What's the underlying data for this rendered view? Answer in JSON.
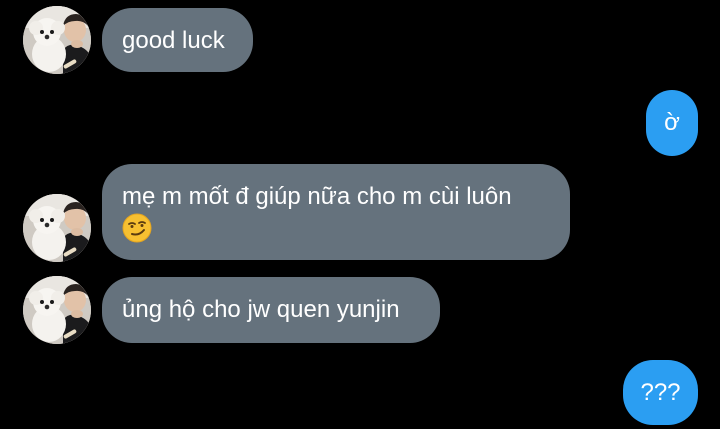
{
  "messages": [
    {
      "id": "m1",
      "direction": "incoming",
      "text": "good luck"
    },
    {
      "id": "m2",
      "direction": "outgoing",
      "text": "ờ"
    },
    {
      "id": "m3",
      "direction": "incoming",
      "text": "mẹ m mốt đ giúp nữa cho m cùi luôn",
      "emoji": "smirking-face"
    },
    {
      "id": "m4",
      "direction": "incoming",
      "text": "ủng hộ cho jw quen yunjin"
    },
    {
      "id": "m5",
      "direction": "outgoing",
      "text": "???"
    }
  ],
  "colors": {
    "background": "#000000",
    "incoming_bubble": "#65727d",
    "outgoing_bubble": "#2b9ef2",
    "text": "#ffffff"
  },
  "icons": {
    "avatar": "contact-avatar-person-with-white-dog",
    "emoji": "smirking-face-emoji"
  }
}
